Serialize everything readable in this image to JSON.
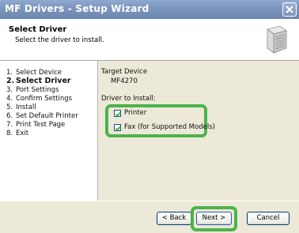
{
  "window": {
    "title": "MF Drivers - Setup Wizard",
    "close_icon": "close-icon"
  },
  "header": {
    "title": "Select Driver",
    "subtitle": "Select the driver to install.",
    "icon": "printer-icon"
  },
  "steps": [
    {
      "num": "1.",
      "label": "Select Device"
    },
    {
      "num": "2.",
      "label": "Select Driver"
    },
    {
      "num": "3.",
      "label": "Port Settings"
    },
    {
      "num": "4.",
      "label": "Confirm Settings"
    },
    {
      "num": "5.",
      "label": "Install"
    },
    {
      "num": "6.",
      "label": "Set Default Printer"
    },
    {
      "num": "7.",
      "label": "Print Test Page"
    },
    {
      "num": "8.",
      "label": "Exit"
    }
  ],
  "active_step": 2,
  "main": {
    "target_label": "Target Device",
    "target_value": "MF4270",
    "driver_label": "Driver to Install:",
    "options": [
      {
        "label": "Printer",
        "checked": true
      },
      {
        "label": "Fax (for Supported Models)",
        "checked": true
      }
    ]
  },
  "buttons": {
    "back": "< Back",
    "next": "Next >",
    "cancel": "Cancel"
  },
  "colors": {
    "highlight": "#4db34a",
    "titlebar": "#7d96bf"
  }
}
